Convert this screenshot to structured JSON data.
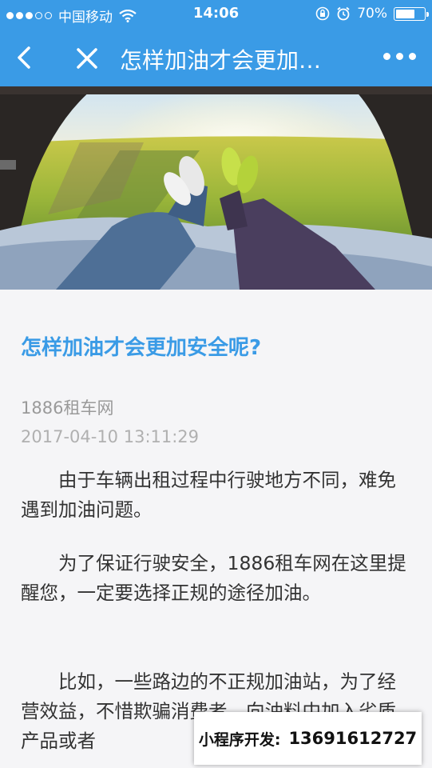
{
  "status_bar": {
    "carrier": "中国移动",
    "time": "14:06",
    "battery": "70%",
    "battery_level": 0.7
  },
  "nav": {
    "title": "怎样加油才会更加…"
  },
  "article": {
    "title": "怎样加油才会更加安全呢?",
    "source": "1886租车网",
    "date": "2017-04-10 13:11:29",
    "paragraphs": [
      "由于车辆出租过程中行驶地方不同，难免遇到加油问题。",
      "为了保证行驶安全，1886租车网在这里提醒您，一定要选择正规的途径加油。",
      "比如，一些路边的不正规加油站，为了经营效益，不惜欺骗消费者，向油料中加入劣质产品或者"
    ]
  },
  "promo": {
    "label": "小程序开发:",
    "phone": "13691612727"
  },
  "colors": {
    "accent": "#3a9be6"
  }
}
